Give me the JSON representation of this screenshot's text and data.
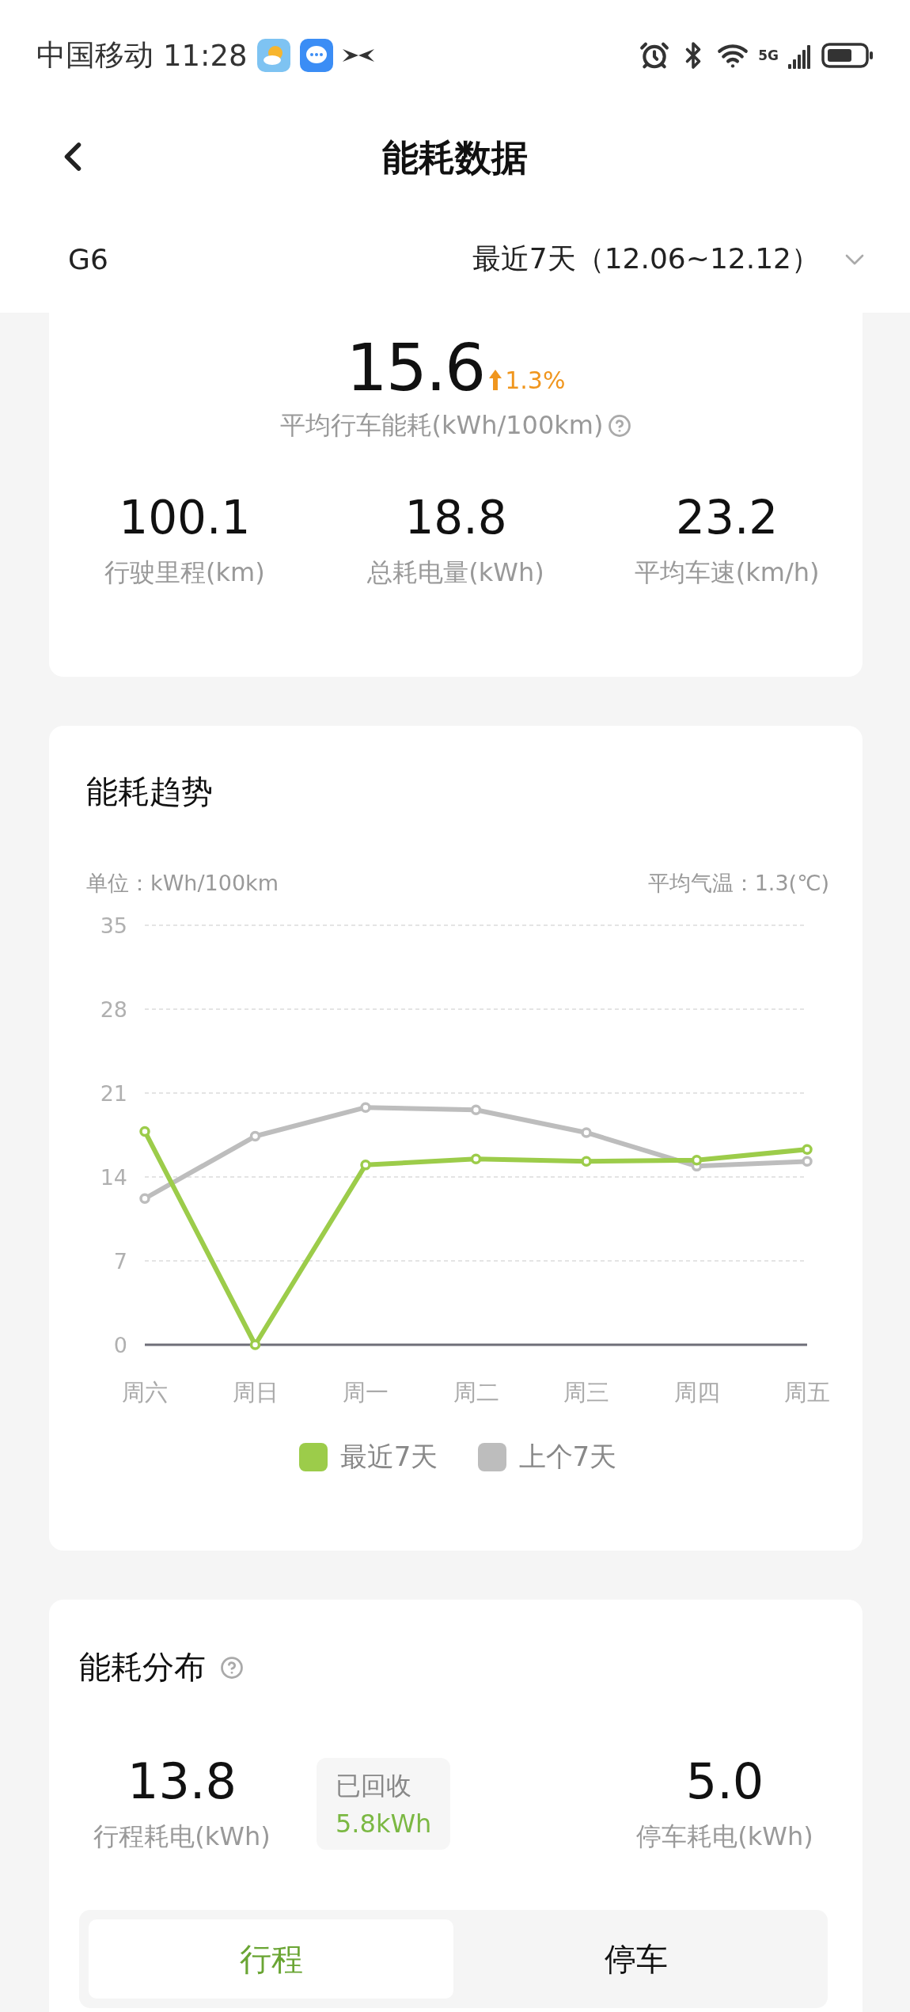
{
  "status_bar": {
    "carrier": "中国移动",
    "time": "11:28",
    "network": "5G"
  },
  "header": {
    "title": "能耗数据"
  },
  "selector": {
    "vehicle": "G6",
    "period": "最近7天（12.06~12.12）"
  },
  "summary": {
    "value": "15.6",
    "change": {
      "value": "1.3%"
    },
    "label": "平均行车能耗(kWh/100km)",
    "stats": [
      {
        "value": "100.1",
        "label": "行驶里程(km)"
      },
      {
        "value": "18.8",
        "label": "总耗电量(kWh)"
      },
      {
        "value": "23.2",
        "label": "平均车速(km/h)"
      }
    ]
  },
  "trend": {
    "title": "能耗趋势",
    "unit": "单位：kWh/100km",
    "temperature": "平均气温：1.3(℃)",
    "chart_data": {
      "type": "line",
      "categories": [
        "周六",
        "周日",
        "周一",
        "周二",
        "周三",
        "周四",
        "周五"
      ],
      "ylim": [
        0,
        35
      ],
      "grid": true,
      "yticks": [
        0,
        7,
        14,
        21,
        28,
        35
      ],
      "series": [
        {
          "name": "最近7天",
          "color": "#9ccc4a",
          "marker": true,
          "values": [
            17.8,
            0,
            15.0,
            15.5,
            15.3,
            15.4,
            16.3
          ]
        },
        {
          "name": "上个7天",
          "color": "#bdbdbd",
          "marker": true,
          "values": [
            12.2,
            17.4,
            19.8,
            19.6,
            17.7,
            14.9,
            15.3
          ]
        }
      ]
    }
  },
  "distribution": {
    "title": "能耗分布",
    "driving": {
      "value": "13.8",
      "label": "行程耗电(kWh)"
    },
    "recovered": {
      "label": "已回收",
      "value": "5.8kWh"
    },
    "parking": {
      "value": "5.0",
      "label": "停车耗电(kWh)"
    },
    "tabs": [
      {
        "label": "行程",
        "selected": true
      },
      {
        "label": "停车",
        "selected": false
      }
    ]
  }
}
